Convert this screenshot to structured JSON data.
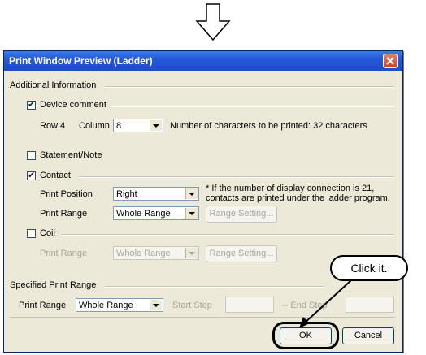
{
  "dialog": {
    "title": "Print Window Preview (Ladder)"
  },
  "additional_info": {
    "label": "Additional Information",
    "device_comment": {
      "label": "Device comment",
      "checked": true,
      "row_label": "Row:4",
      "column_label": "Column",
      "column_value": "8",
      "chars_text": "Number of characters to be printed: 32 characters"
    },
    "statement_note": {
      "label": "Statement/Note",
      "checked": false
    },
    "contact": {
      "label": "Contact",
      "checked": true,
      "print_position_label": "Print Position",
      "print_position_value": "Right",
      "note_line1": "* If the number of display connection is 21,",
      "note_line2": "contacts are printed under the ladder program.",
      "print_range_label": "Print Range",
      "print_range_value": "Whole Range",
      "range_setting_label": "Range Setting..."
    },
    "coil": {
      "label": "Coil",
      "checked": false,
      "print_range_label": "Print Range",
      "print_range_value": "Whole Range",
      "range_setting_label": "Range Setting..."
    }
  },
  "specified_range": {
    "label": "Specified Print Range",
    "print_range_label": "Print Range",
    "print_range_value": "Whole Range",
    "start_step_label": "Start Step",
    "end_step_label": "-- End Step"
  },
  "buttons": {
    "ok": "OK",
    "cancel": "Cancel"
  },
  "callout": {
    "text": "Click it."
  },
  "icons": {
    "top_arrow": "down-arrow-icon",
    "close": "close-icon"
  },
  "colors": {
    "titlebar": "#2458d8",
    "dialog_bg": "#ece9d8",
    "close_button": "#d0502c"
  }
}
